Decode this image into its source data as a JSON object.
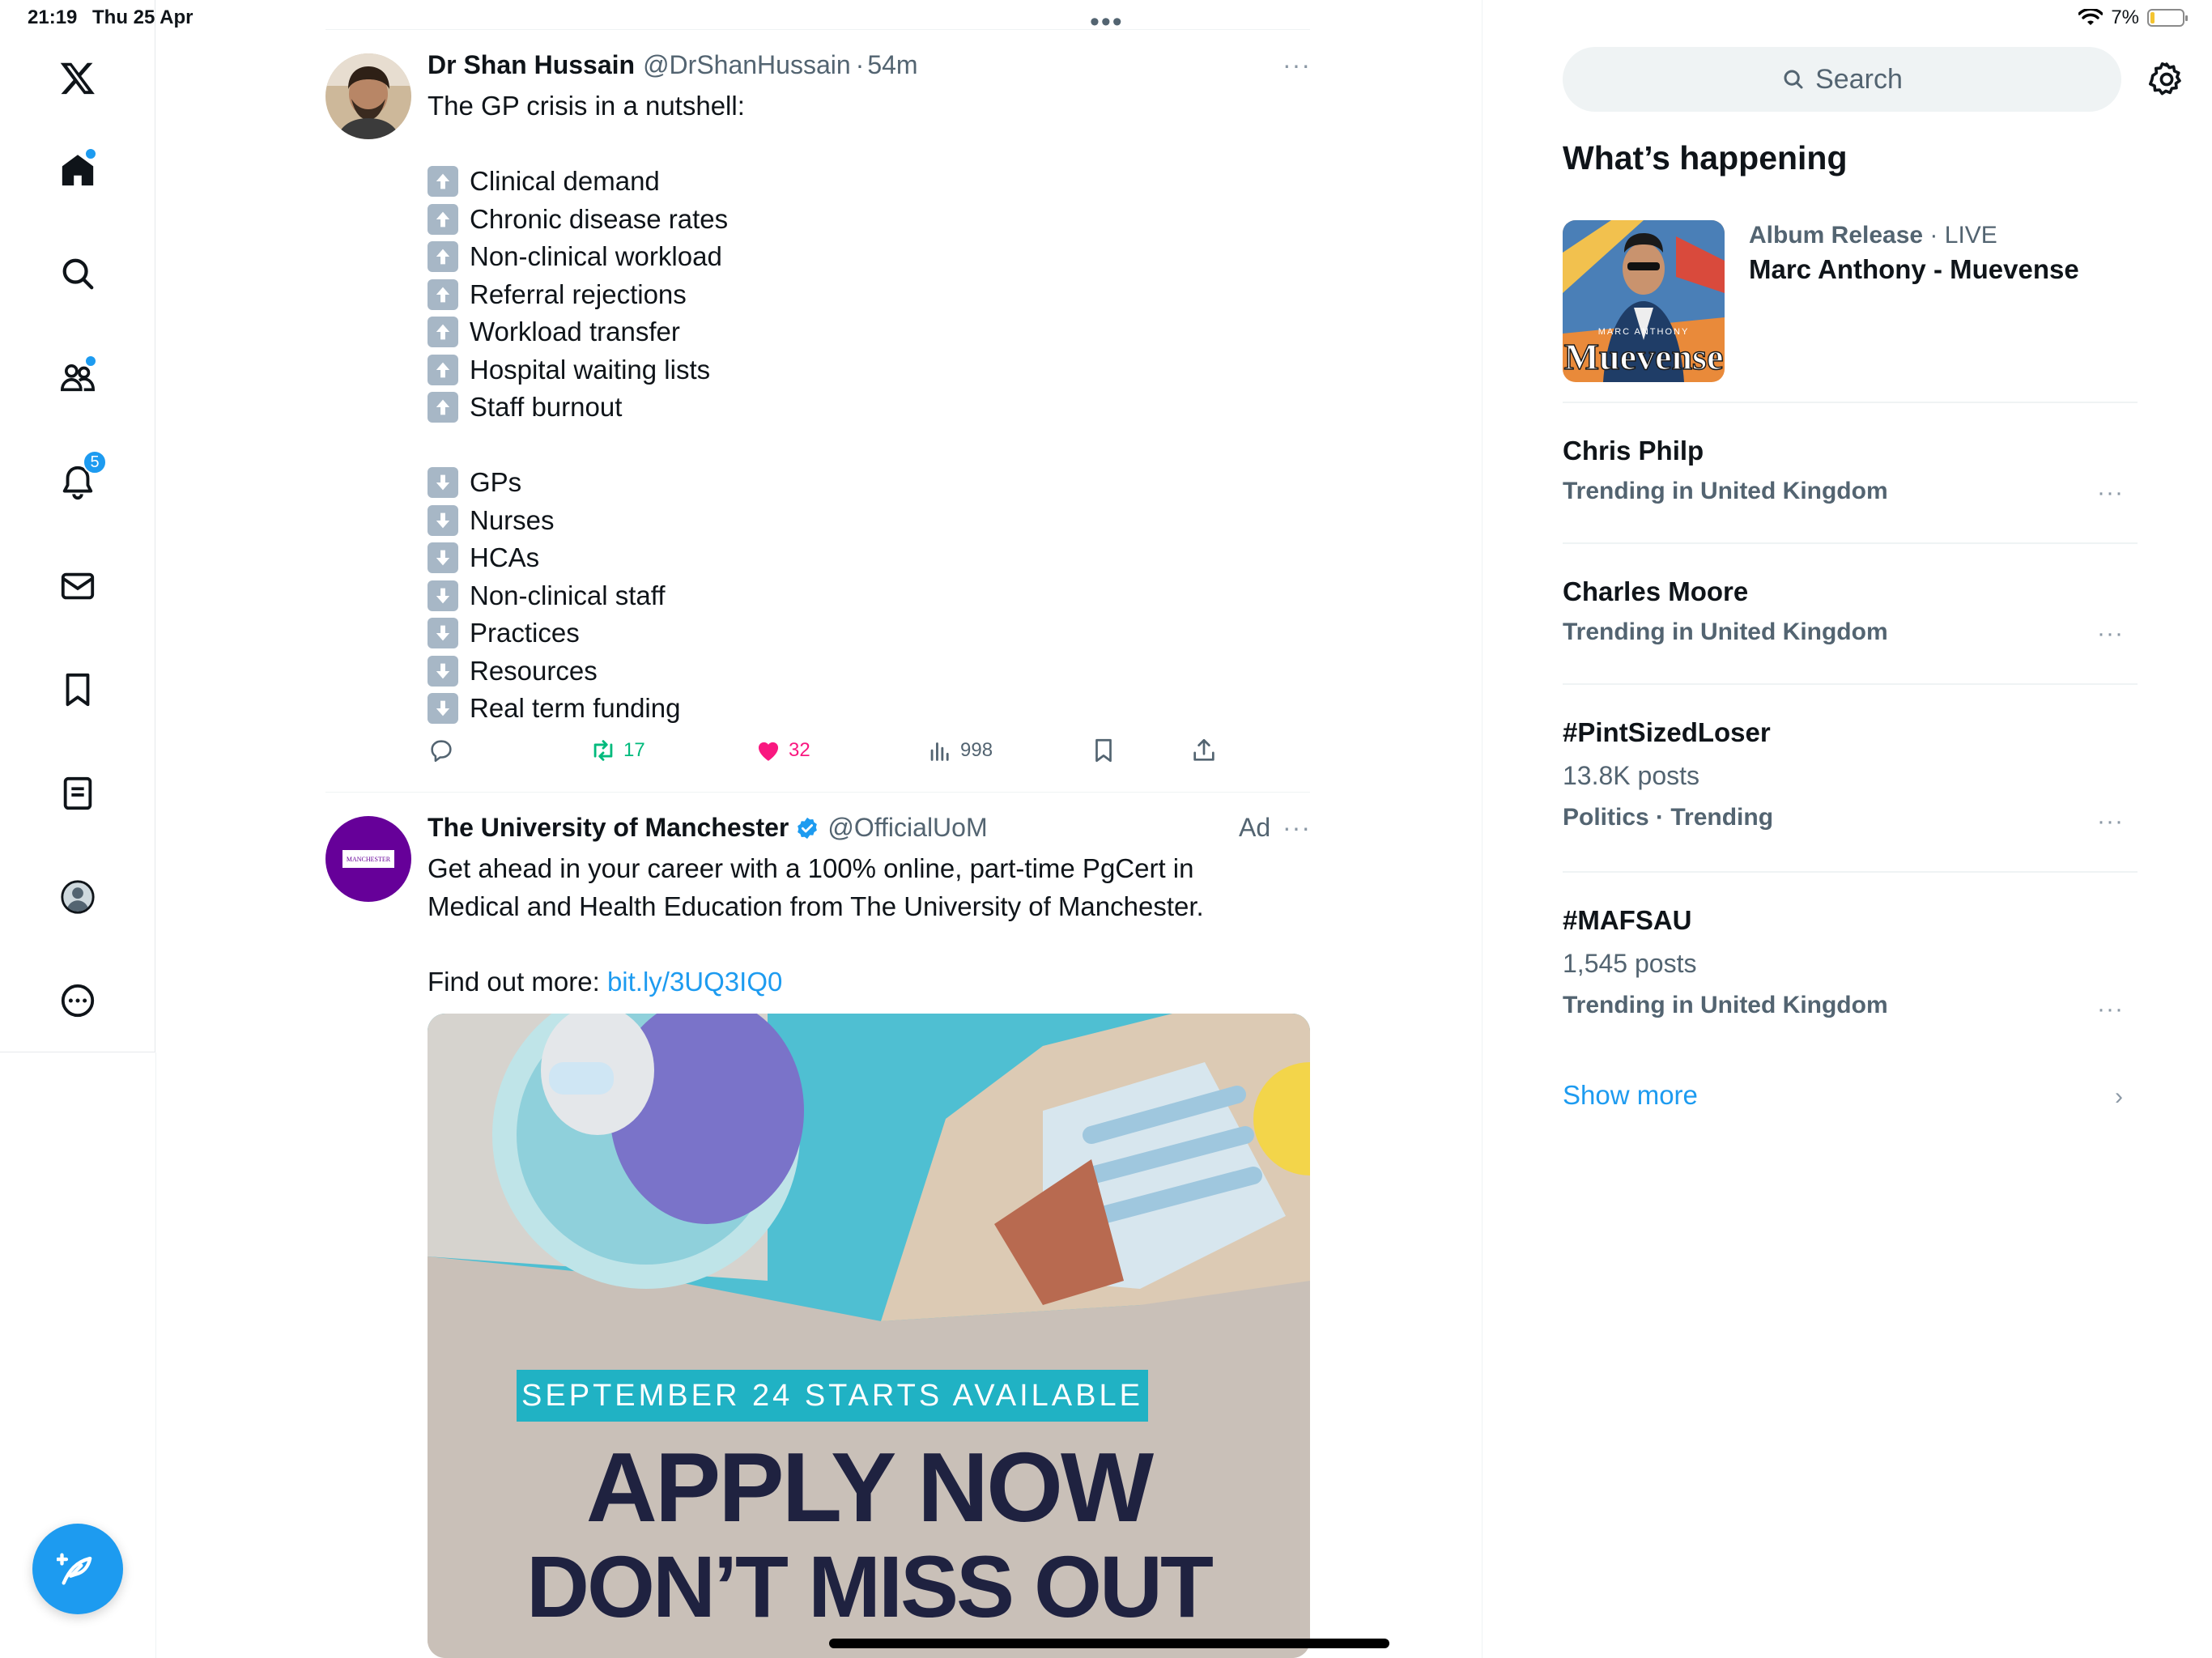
{
  "status_bar": {
    "time": "21:19",
    "date": "Thu 25 Apr",
    "battery": "7%"
  },
  "nav": {
    "notifications_badge": "5",
    "items": [
      "x-logo",
      "home-icon",
      "search-icon",
      "communities-icon",
      "notifications-icon",
      "messages-icon",
      "bookmarks-icon",
      "lists-icon",
      "profile-icon",
      "more-icon"
    ]
  },
  "timeline": {
    "top_more": "•••",
    "tweet1": {
      "name": "Dr Shan Hussain",
      "handle": "@DrShanHussain",
      "sep": "·",
      "time": "54m",
      "more": "···",
      "intro": "The GP crisis in a nutshell:",
      "up_items": [
        "Clinical demand",
        "Chronic disease rates",
        "Non-clinical workload",
        "Referral rejections",
        "Workload transfer",
        "Hospital waiting lists",
        "Staff burnout"
      ],
      "down_items": [
        "GPs",
        "Nurses",
        "HCAs",
        "Non-clinical staff",
        "Practices",
        "Resources",
        "Real term funding"
      ],
      "retweets": "17",
      "likes": "32",
      "views": "998"
    },
    "tweet2": {
      "name": "The University of Manchester",
      "handle": "@OfficialUoM",
      "ad_label": "Ad",
      "more": "···",
      "avatar_text": "MANCHESTER",
      "body_line1": "Get ahead in your career with a 100% online, part-time PgCert in",
      "body_line2": "Medical and Health Education from The University of Manchester.",
      "find_out": "Find out more: ",
      "link": "bit.ly/3UQ3IQ0",
      "image": {
        "banner": "SEPTEMBER 24 STARTS AVAILABLE",
        "headline1": "APPLY NOW",
        "headline2": "DON’T MISS OUT"
      }
    }
  },
  "sidebar": {
    "search_placeholder": "Search",
    "whats_happening": "What’s happening",
    "album": {
      "category": "Album Release",
      "sep": " · ",
      "live": "LIVE",
      "title": "Marc Anthony - Muevense",
      "cover_artist": "MARC ANTHONY",
      "cover_title": "Muevense"
    },
    "trends": [
      {
        "name": "Chris Philp",
        "context": "Trending in United Kingdom",
        "count": ""
      },
      {
        "name": "Charles Moore",
        "context": "Trending in United Kingdom",
        "count": ""
      },
      {
        "name": "#PintSizedLoser",
        "context": "Politics · Trending",
        "count": "13.8K posts"
      },
      {
        "name": "#MAFSAU",
        "context": "Trending in United Kingdom",
        "count": "1,545 posts"
      }
    ],
    "trend_more": "···",
    "show_more": "Show more",
    "chevron": "›"
  },
  "colors": {
    "accent": "#1d9bf0",
    "like": "#f91880",
    "retweet": "#00ba7c",
    "text": "#0f1419",
    "secondary": "#536471",
    "arrow_box": "#a7b7c6",
    "uom_purple": "#660099"
  }
}
